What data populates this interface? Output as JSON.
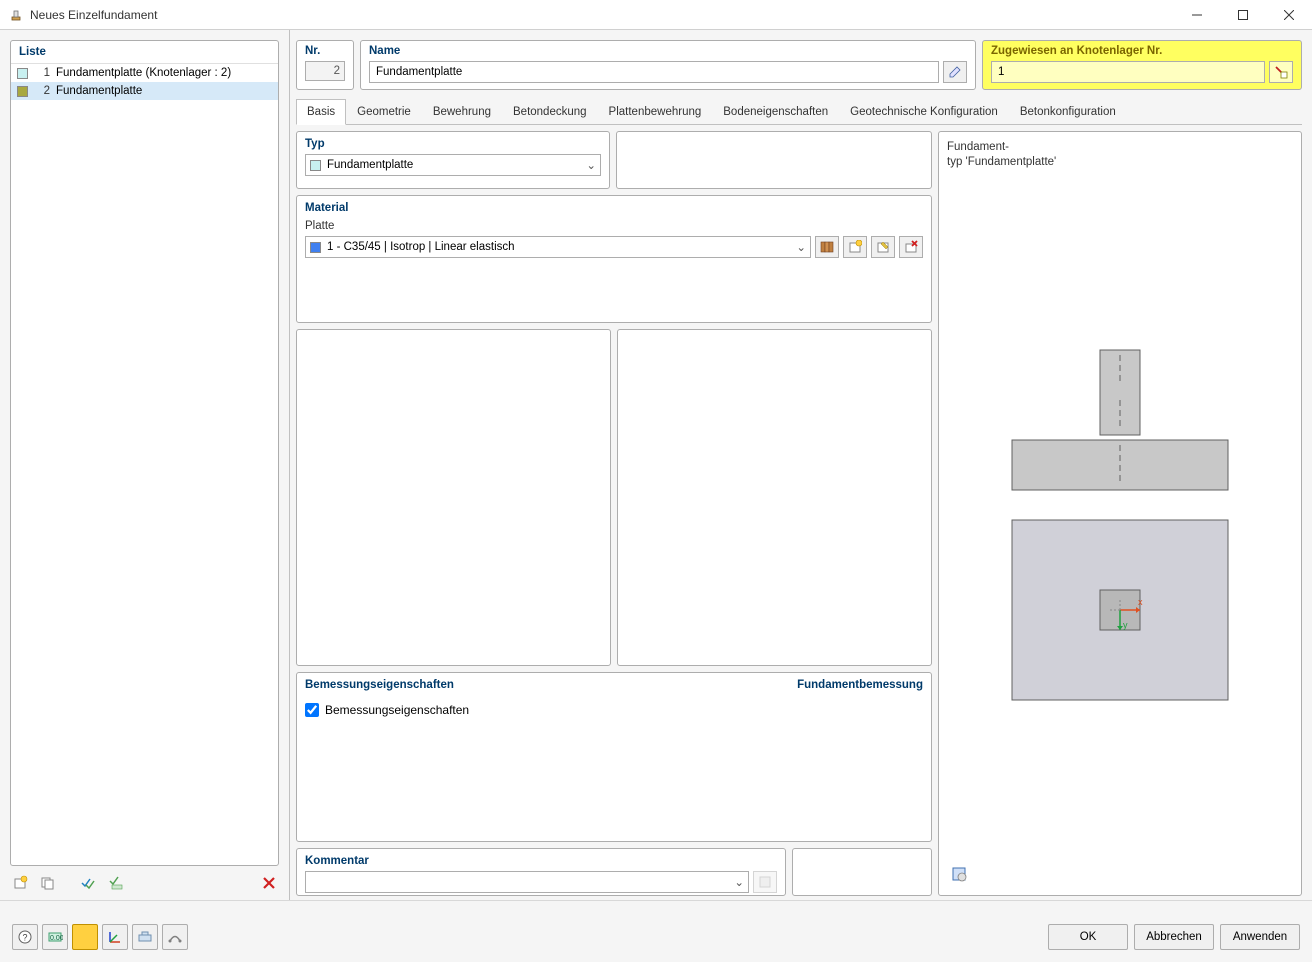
{
  "titlebar": {
    "title": "Neues Einzelfundament"
  },
  "list": {
    "header": "Liste",
    "items": [
      {
        "num": "1",
        "label": "Fundamentplatte (Knotenlager : 2)"
      },
      {
        "num": "2",
        "label": "Fundamentplatte"
      }
    ]
  },
  "header": {
    "nr_label": "Nr.",
    "nr_value": "2",
    "name_label": "Name",
    "name_value": "Fundamentplatte",
    "assigned_label": "Zugewiesen an Knotenlager Nr.",
    "assigned_value": "1"
  },
  "tabs": {
    "t0": "Basis",
    "t1": "Geometrie",
    "t2": "Bewehrung",
    "t3": "Betondeckung",
    "t4": "Plattenbewehrung",
    "t5": "Bodeneigenschaften",
    "t6": "Geotechnische Konfiguration",
    "t7": "Betonkonfiguration"
  },
  "typ": {
    "header": "Typ",
    "value": "Fundamentplatte"
  },
  "material": {
    "header": "Material",
    "plate_label": "Platte",
    "value": "1 - C35/45 | Isotrop | Linear elastisch"
  },
  "design": {
    "left": "Bemessungseigenschaften",
    "right": "Fundamentbemessung",
    "checkbox": "Bemessungseigenschaften"
  },
  "comment": {
    "header": "Kommentar",
    "value": ""
  },
  "preview": {
    "line1": "Fundament-",
    "line2": "typ 'Fundamentplatte'"
  },
  "footer": {
    "ok": "OK",
    "cancel": "Abbrechen",
    "apply": "Anwenden"
  }
}
